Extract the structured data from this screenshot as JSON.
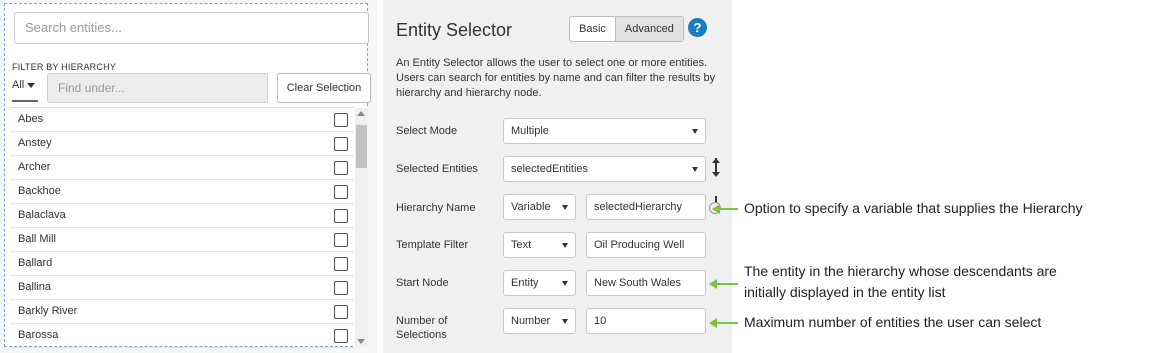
{
  "widget": {
    "search_placeholder": "Search entities...",
    "filter_label": "FILTER BY HIERARCHY",
    "all_dropdown": "All",
    "find_under_placeholder": "Find under...",
    "clear_selection_label": "Clear Selection",
    "entities": [
      "Abes",
      "Anstey",
      "Archer",
      "Backhoe",
      "Balaclava",
      "Ball Mill",
      "Ballard",
      "Ballina",
      "Barkly River",
      "Barossa"
    ]
  },
  "panel": {
    "title": "Entity Selector",
    "mode_basic": "Basic",
    "mode_advanced": "Advanced",
    "help_icon": "?",
    "description": "An Entity Selector allows the user to select one or more entities. Users can search for entities by name and can filter the results by hierarchy and hierarchy node.",
    "rows": {
      "select_mode": {
        "label": "Select Mode",
        "value": "Multiple"
      },
      "selected_entities": {
        "label": "Selected Entities",
        "value": "selectedEntities"
      },
      "hierarchy_name": {
        "label": "Hierarchy Name",
        "type": "Variable",
        "value": "selectedHierarchy"
      },
      "template_filter": {
        "label": "Template Filter",
        "type": "Text",
        "value": "Oil Producing Well"
      },
      "start_node": {
        "label": "Start Node",
        "type": "Entity",
        "value": "New South Wales"
      },
      "number_of_selections": {
        "label": "Number of Selections",
        "type": "Number",
        "value": "10"
      }
    }
  },
  "annotations": {
    "hierarchy": "Option to specify a variable that supplies the Hierarchy",
    "start_node_line1": "The entity in the hierarchy whose descendants are",
    "start_node_line2": "initially displayed in the entity list",
    "max_selections": "Maximum number of entities the user can select"
  },
  "colors": {
    "accent_blue": "#1a7cc1",
    "callout_green": "#7dc242",
    "selection_border": "#7aa5d6"
  }
}
